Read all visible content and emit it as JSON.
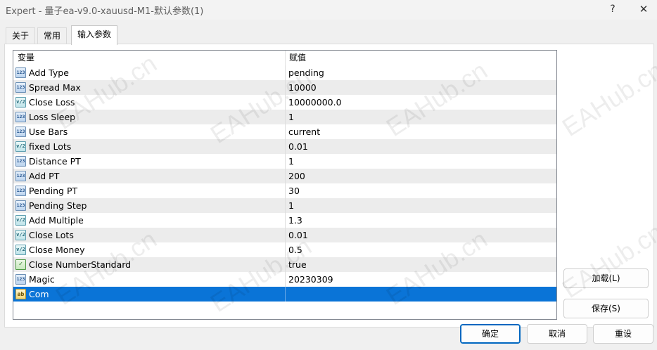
{
  "window": {
    "title": "Expert - 量子ea-v9.0-xauusd-M1-默认参数(1)",
    "help_glyph": "?",
    "close_glyph": "✕"
  },
  "tabs": [
    {
      "label": "关于"
    },
    {
      "label": "常用"
    },
    {
      "label": "输入参数"
    }
  ],
  "grid": {
    "headers": {
      "name": "变量",
      "value": "赋值"
    },
    "rows": [
      {
        "icon": "123",
        "name": "Add Type",
        "value": "pending"
      },
      {
        "icon": "123",
        "name": "Spread Max",
        "value": "10000"
      },
      {
        "icon": "v/2",
        "name": "Close Loss",
        "value": "10000000.0"
      },
      {
        "icon": "123",
        "name": "Loss Sleep",
        "value": "1"
      },
      {
        "icon": "123",
        "name": "Use Bars",
        "value": "current"
      },
      {
        "icon": "v/2",
        "name": "fixed Lots",
        "value": "0.01"
      },
      {
        "icon": "123",
        "name": "Distance PT",
        "value": "1"
      },
      {
        "icon": "123",
        "name": "Add PT",
        "value": "200"
      },
      {
        "icon": "123",
        "name": "Pending PT",
        "value": "30"
      },
      {
        "icon": "123",
        "name": "Pending Step",
        "value": "1"
      },
      {
        "icon": "v/2",
        "name": "Add Multiple",
        "value": "1.3"
      },
      {
        "icon": "v/2",
        "name": "Close Lots",
        "value": "0.01"
      },
      {
        "icon": "v/2",
        "name": "Close Money",
        "value": "0.5"
      },
      {
        "icon": "✓",
        "name": "Close NumberStandard",
        "value": "true"
      },
      {
        "icon": "123",
        "name": "Magic",
        "value": "20230309"
      },
      {
        "icon": "ab",
        "name": "Com",
        "value": ""
      }
    ]
  },
  "buttons": {
    "load": "加载(L)",
    "save": "保存(S)",
    "ok": "确定",
    "cancel": "取消",
    "reset": "重设"
  },
  "watermark": "EAHub.cn",
  "colors": {
    "selection": "#0a74d7",
    "primary_border": "#0067c0"
  }
}
